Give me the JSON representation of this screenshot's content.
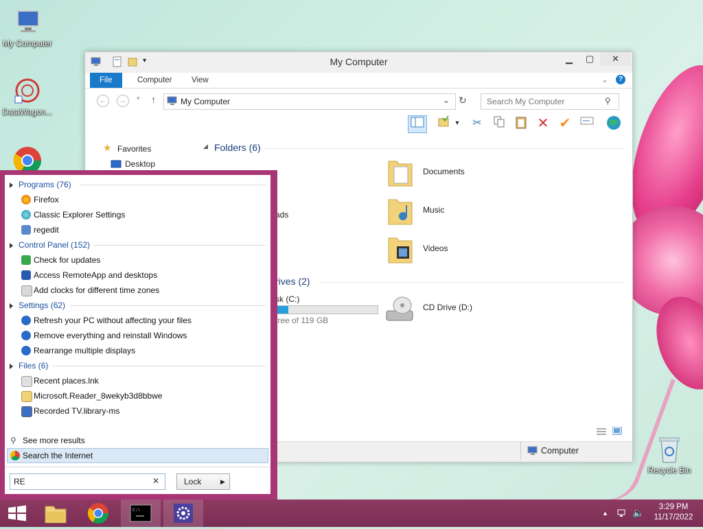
{
  "desktop": {
    "icons": [
      {
        "label": "My Computer",
        "icon": "computer-icon"
      },
      {
        "label": "DataWagon...",
        "icon": "datawagon-icon"
      },
      {
        "label": "Recycle Bin",
        "icon": "recycle-bin-icon"
      }
    ]
  },
  "explorer": {
    "title": "My Computer",
    "tabs": [
      "File",
      "Computer",
      "View"
    ],
    "address": "My Computer",
    "search_placeholder": "Search My Computer",
    "nav": {
      "favorites": "Favorites",
      "desktop": "Desktop"
    },
    "folders_header": "Folders (6)",
    "folders": [
      {
        "label": "Documents"
      },
      {
        "label": "Music"
      },
      {
        "label": "Videos"
      },
      {
        "label": "ads"
      }
    ],
    "drives_header": "rives (2)",
    "drives": [
      {
        "label": "sk (C:)",
        "free": "free of 119 GB",
        "used_fraction": 0.12
      },
      {
        "label": "CD Drive (D:)"
      }
    ],
    "status_location": "Computer"
  },
  "start_menu": {
    "groups": [
      {
        "header": "Programs (76)",
        "items": [
          "Firefox",
          "Classic Explorer Settings",
          "regedit"
        ]
      },
      {
        "header": "Control Panel (152)",
        "items": [
          "Check for updates",
          "Access RemoteApp and desktops",
          "Add clocks for different time zones"
        ]
      },
      {
        "header": "Settings (62)",
        "items": [
          "Refresh your PC without affecting your files",
          "Remove everything and reinstall Windows",
          "Rearrange multiple displays"
        ]
      },
      {
        "header": "Files (6)",
        "items": [
          "Recent places.lnk",
          "Microsoft.Reader_8wekyb3d8bbwe",
          "Recorded TV.library-ms"
        ]
      }
    ],
    "see_more": "See more results",
    "search_internet": "Search the Internet",
    "search_value": "RE",
    "lock_label": "Lock"
  },
  "taskbar": {
    "time": "3:29 PM",
    "date": "11/17/2022"
  }
}
